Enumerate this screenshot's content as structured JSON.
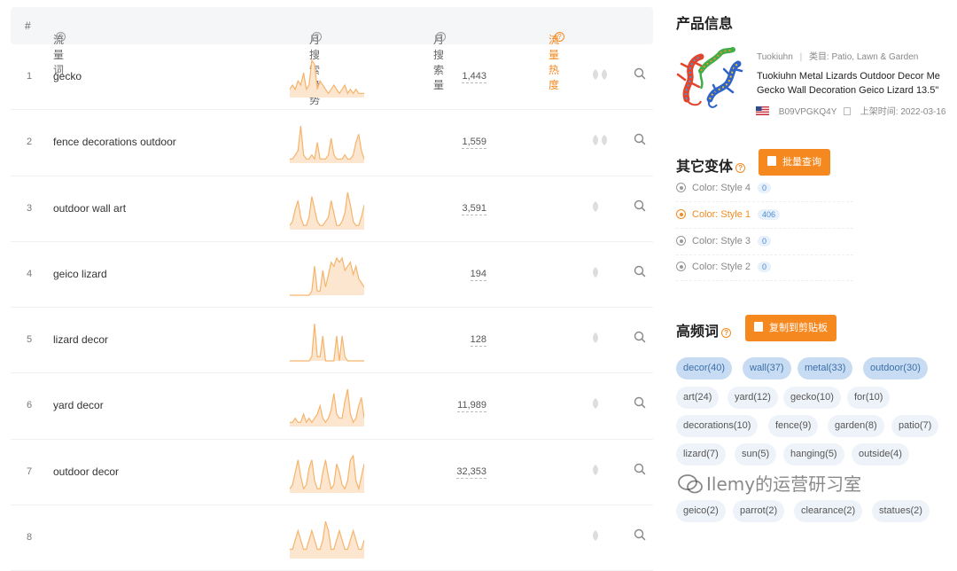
{
  "table": {
    "headers": {
      "num": "#",
      "keyword": "流量词",
      "trend": "月搜索趋势",
      "volume": "月搜索量",
      "heat": "流量热度"
    },
    "rows": [
      {
        "idx": "1",
        "keyword": "gecko",
        "volume": "1,443",
        "leaf_count": 2,
        "trend": [
          2,
          3,
          2,
          4,
          3,
          6,
          2,
          3,
          9,
          8,
          2,
          4,
          3,
          2,
          1,
          2,
          3,
          2,
          1,
          2,
          3,
          1,
          2,
          1,
          2,
          1,
          1,
          1
        ]
      },
      {
        "idx": "2",
        "keyword": "fence decorations outdoor",
        "volume": "1,559",
        "leaf_count": 2,
        "trend": [
          1,
          1,
          2,
          3,
          9,
          2,
          1,
          1,
          2,
          1,
          5,
          1,
          1,
          1,
          2,
          6,
          2,
          1,
          1,
          1,
          2,
          1,
          1,
          2,
          5,
          7,
          3,
          1
        ]
      },
      {
        "idx": "3",
        "keyword": "outdoor wall art",
        "volume": "3,591",
        "leaf_count": 1,
        "trend": [
          1,
          2,
          5,
          7,
          3,
          1,
          1,
          3,
          8,
          5,
          2,
          1,
          1,
          2,
          3,
          7,
          4,
          1,
          1,
          2,
          4,
          9,
          6,
          2,
          1,
          1,
          3,
          6
        ]
      },
      {
        "idx": "4",
        "keyword": "geico lizard",
        "volume": "194",
        "leaf_count": 1,
        "trend": [
          0,
          0,
          0,
          0,
          0,
          0,
          0,
          0,
          1,
          7,
          1,
          1,
          6,
          2,
          5,
          8,
          7,
          9,
          8,
          9,
          6,
          7,
          8,
          5,
          7,
          4,
          3,
          2
        ]
      },
      {
        "idx": "5",
        "keyword": "lizard decor",
        "volume": "128",
        "leaf_count": 1,
        "trend": [
          0,
          0,
          0,
          0,
          0,
          0,
          0,
          0,
          1,
          9,
          1,
          1,
          6,
          0,
          0,
          0,
          0,
          6,
          0,
          6,
          1,
          0,
          0,
          0,
          0,
          0,
          0,
          0
        ]
      },
      {
        "idx": "6",
        "keyword": "yard decor",
        "volume": "11,989",
        "leaf_count": 1,
        "trend": [
          1,
          1,
          2,
          1,
          1,
          3,
          1,
          2,
          1,
          2,
          3,
          5,
          2,
          1,
          2,
          4,
          8,
          3,
          2,
          2,
          6,
          9,
          3,
          1,
          2,
          5,
          7,
          2
        ]
      },
      {
        "idx": "7",
        "keyword": "outdoor decor",
        "volume": "32,353",
        "leaf_count": 1,
        "trend": [
          1,
          2,
          5,
          8,
          4,
          1,
          2,
          6,
          8,
          3,
          1,
          1,
          5,
          8,
          4,
          1,
          2,
          7,
          5,
          2,
          1,
          3,
          8,
          9,
          3,
          1,
          4,
          7
        ]
      },
      {
        "idx": "8",
        "keyword": "",
        "volume": "",
        "leaf_count": 1,
        "trend": [
          1,
          1,
          2,
          3,
          2,
          1,
          1,
          2,
          3,
          2,
          1,
          1,
          2,
          4,
          3,
          1,
          1,
          2,
          3,
          2,
          1,
          1,
          2,
          3,
          2,
          1,
          1,
          2
        ]
      }
    ]
  },
  "product": {
    "section_title": "产品信息",
    "brand": "Tuokiuhn",
    "category_label": "类目: Patio, Lawn & Garden",
    "title_line1": "Tuokiuhn Metal Lizards Outdoor Decor Me",
    "title_line2": "Gecko Wall Decoration Geico Lizard 13.5\"",
    "asin": "B09VPGKQ4Y",
    "launch_date": "上架时间: 2022-03-16"
  },
  "variants": {
    "section_title": "其它变体",
    "button_label": "批量查询",
    "items": [
      {
        "label": "Color: Style 4",
        "count": "0",
        "active": false
      },
      {
        "label": "Color: Style 1",
        "count": "406",
        "active": true
      },
      {
        "label": "Color: Style 3",
        "count": "0",
        "active": false
      },
      {
        "label": "Color: Style 2",
        "count": "0",
        "active": false
      }
    ]
  },
  "keywords": {
    "section_title": "高频词",
    "button_label": "复制到剪贴板",
    "tags": [
      {
        "label": "decor(40)",
        "hi": true
      },
      {
        "label": "wall(37)",
        "hi": true
      },
      {
        "label": "metal(33)",
        "hi": true
      },
      {
        "label": "outdoor(30)",
        "hi": true
      },
      {
        "label": "art(24)",
        "hi": false
      },
      {
        "label": "yard(12)",
        "hi": false
      },
      {
        "label": "gecko(10)",
        "hi": false
      },
      {
        "label": "for(10)",
        "hi": false
      },
      {
        "label": "decorations(10)",
        "hi": false
      },
      {
        "label": "fence(9)",
        "hi": false
      },
      {
        "label": "garden(8)",
        "hi": false
      },
      {
        "label": "patio(7)",
        "hi": false
      },
      {
        "label": "lizard(7)",
        "hi": false
      },
      {
        "label": "sun(5)",
        "hi": false
      },
      {
        "label": "hanging(5)",
        "hi": false
      },
      {
        "label": "outside(4)",
        "hi": false
      },
      {
        "label": "geico(2)",
        "hi": false
      },
      {
        "label": "parrot(2)",
        "hi": false
      },
      {
        "label": "clearance(2)",
        "hi": false
      },
      {
        "label": "statues(2)",
        "hi": false
      }
    ]
  },
  "watermark": "Ilemy的运营研习室",
  "colors": {
    "accent": "#f5891f",
    "chart_line": "#f5b46a",
    "chart_fill": "#fde6cf",
    "tag_hi": "#c7dcf3",
    "tag": "#eef3f9"
  }
}
